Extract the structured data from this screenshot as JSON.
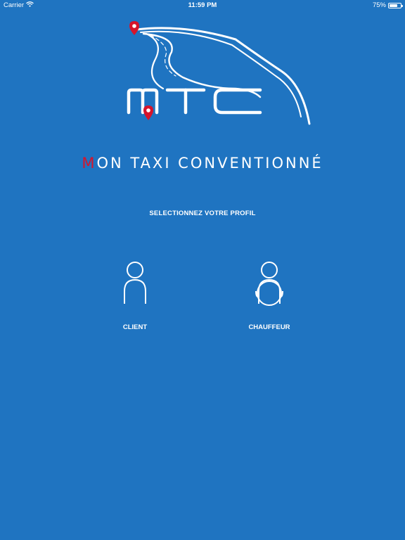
{
  "status_bar": {
    "carrier": "Carrier",
    "time": "11:59 PM",
    "battery": "75%",
    "battery_level": 0.75
  },
  "brand": {
    "logo_text": "MTC",
    "title_accent": "M",
    "title_rest": "ON TAXI CONVENTIONNÉ"
  },
  "profile_prompt": "SELECTIONNEZ VOTRE PROFIL",
  "profiles": [
    {
      "label": "CLIENT",
      "icon": "person-icon"
    },
    {
      "label": "CHAUFFEUR",
      "icon": "driver-icon"
    }
  ],
  "colors": {
    "background": "#1f74c1",
    "foreground": "#ffffff",
    "accent": "#d6142b"
  }
}
